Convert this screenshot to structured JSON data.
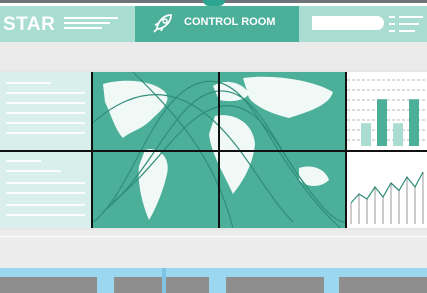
{
  "header": {
    "brand": "STAR",
    "control_room_label": "CONTROL ROOM"
  },
  "icons": {
    "rocket": "rocket-icon",
    "menu": "menu-icon"
  },
  "colors": {
    "accent": "#4caf9a",
    "header_light": "#a9ddd1",
    "panel_light": "#d9efeb",
    "floor_blue": "#9bd7ef"
  },
  "chart_data": [
    {
      "type": "bar",
      "categories": [
        "1",
        "2",
        "3",
        "4"
      ],
      "values": [
        0.38,
        0.78,
        0.38,
        0.78
      ]
    },
    {
      "type": "line",
      "x": [
        1,
        2,
        3,
        4,
        5,
        6,
        7,
        8,
        9,
        10
      ],
      "values": [
        0.3,
        0.48,
        0.38,
        0.62,
        0.42,
        0.7,
        0.55,
        0.82,
        0.62,
        0.92
      ]
    }
  ]
}
